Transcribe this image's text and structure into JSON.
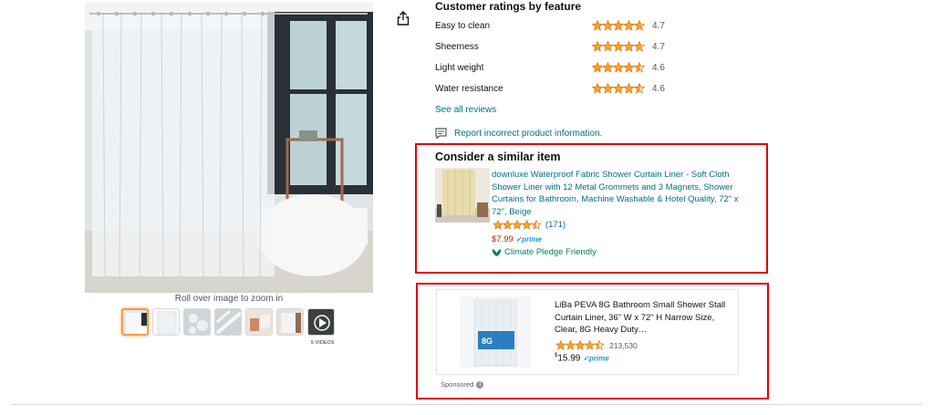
{
  "gallery": {
    "zoom_hint": "Roll over image to zoom in",
    "videos_label": "5 VIDEOS",
    "thumbnail_count": 7
  },
  "ratings": {
    "title": "Customer ratings by feature",
    "features": [
      {
        "label": "Easy to clean",
        "value": "4.7",
        "rating": 4.7
      },
      {
        "label": "Sheerness",
        "value": "4.7",
        "rating": 4.7
      },
      {
        "label": "Light weight",
        "value": "4.6",
        "rating": 4.6
      },
      {
        "label": "Water resistance",
        "value": "4.6",
        "rating": 4.6
      }
    ],
    "see_all": "See all reviews"
  },
  "report": {
    "label": "Report incorrect product information."
  },
  "similar": {
    "heading": "Consider a similar item",
    "title": "downluxe Waterproof Fabric Shower Curtain Liner - Soft Cloth Shower Liner with 12 Metal Grommets and 3 Magnets, Shower Curtains for Bathroom, Machine Washable & Hotel Quality, 72\" x 72\", Beige",
    "rating": 4.5,
    "review_count": "(171)",
    "price": "$7.99",
    "prime": "prime",
    "climate": "Climate Pledge Friendly"
  },
  "sponsored": {
    "title": "LiBa PEVA 8G Bathroom Small Shower Stall Curtain Liner, 36\" W x 72\" H Narrow Size, Clear, 8G Heavy Duty…",
    "rating": 4.5,
    "review_count": "213,530",
    "price_symbol": "$",
    "price": "15.99",
    "prime": "prime",
    "label": "Sponsored",
    "badge_text": "8G"
  },
  "colors": {
    "link": "#007185",
    "star": "#ffa41c",
    "price_red": "#b12704",
    "highlight_box": "#e00000",
    "climate_green": "#067d62"
  }
}
